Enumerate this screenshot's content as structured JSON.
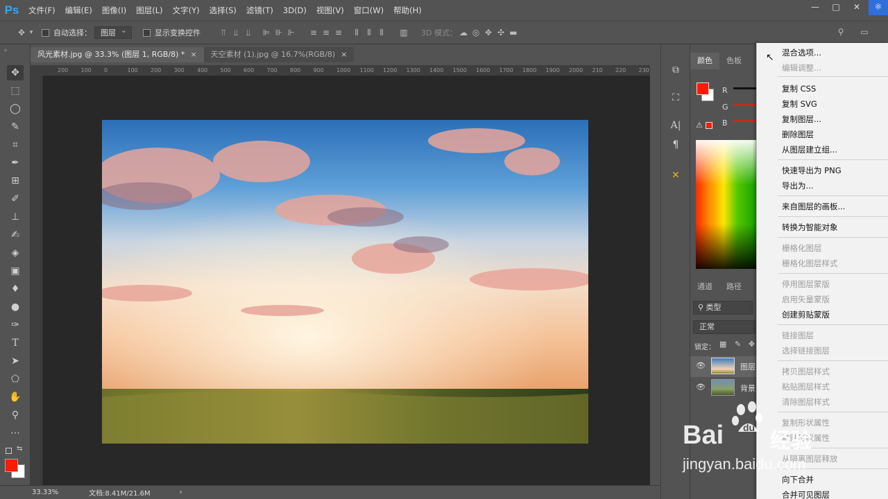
{
  "app": {
    "logo": "Ps"
  },
  "menu": [
    "文件(F)",
    "编辑(E)",
    "图像(I)",
    "图层(L)",
    "文字(Y)",
    "选择(S)",
    "滤镜(T)",
    "3D(D)",
    "视图(V)",
    "窗口(W)",
    "帮助(H)"
  ],
  "window_buttons": {
    "minimize": "—",
    "restore": "□",
    "close": "✕"
  },
  "options": {
    "auto_select_label": "自动选择：",
    "auto_select_value": "图层",
    "show_transform_label": "显示变换控件",
    "mode_3d_label": "3D 模式："
  },
  "tabs": [
    {
      "label": "风光素材.jpg @ 33.3% (图层 1, RGB/8) *",
      "close": "×"
    },
    {
      "label": "天空素材 (1).jpg @ 16.7%(RGB/8)",
      "close": "×"
    }
  ],
  "ruler_ticks": [
    "200",
    "100",
    "0",
    "100",
    "200",
    "300",
    "400",
    "500",
    "600",
    "700",
    "800",
    "900",
    "1000",
    "1100",
    "1200",
    "1300",
    "1400",
    "1500",
    "1600",
    "1700",
    "1800",
    "1900",
    "2000",
    "210",
    "220",
    "230"
  ],
  "status": {
    "zoom": "33.33%",
    "doc": "文档:8.41M/21.6M",
    "arrow": "›"
  },
  "panel": {
    "color_tabs": [
      "颜色",
      "色板"
    ],
    "rgb": [
      "R",
      "G",
      "B"
    ],
    "layer_tabs": [
      "通道",
      "路径"
    ],
    "filter_type": "类型",
    "blend_mode": "正常",
    "lock_label": "锁定：",
    "layers": [
      {
        "name": "图层"
      },
      {
        "name": "背景"
      }
    ]
  },
  "colors": {
    "foreground": "#ff1a00",
    "background": "#ffffff",
    "accent": "#31a8ff"
  },
  "context_menu": [
    {
      "label": "混合选项...",
      "enabled": true
    },
    {
      "label": "编辑调整...",
      "enabled": false
    },
    {
      "label": "复制 CSS",
      "enabled": true
    },
    {
      "label": "复制 SVG",
      "enabled": true
    },
    {
      "label": "复制图层...",
      "enabled": true
    },
    {
      "label": "删除图层",
      "enabled": true
    },
    {
      "label": "从图层建立组...",
      "enabled": true
    },
    {
      "label": "快速导出为 PNG",
      "enabled": true
    },
    {
      "label": "导出为...",
      "enabled": true
    },
    {
      "label": "来自图层的画板...",
      "enabled": true
    },
    {
      "label": "转换为智能对象",
      "enabled": true
    },
    {
      "label": "栅格化图层",
      "enabled": false
    },
    {
      "label": "栅格化图层样式",
      "enabled": false
    },
    {
      "label": "停用图层蒙版",
      "enabled": false
    },
    {
      "label": "启用矢量蒙版",
      "enabled": false
    },
    {
      "label": "创建剪贴蒙版",
      "enabled": true
    },
    {
      "label": "链接图层",
      "enabled": false
    },
    {
      "label": "选择链接图层",
      "enabled": false
    },
    {
      "label": "拷贝图层样式",
      "enabled": false
    },
    {
      "label": "粘贴图层样式",
      "enabled": false
    },
    {
      "label": "清除图层样式",
      "enabled": false
    },
    {
      "label": "复制形状属性",
      "enabled": false
    },
    {
      "label": "粘贴形状属性",
      "enabled": false
    },
    {
      "label": "从隔离图层释放",
      "enabled": false
    },
    {
      "label": "向下合并",
      "enabled": true
    },
    {
      "label": "合并可见图层",
      "enabled": true
    }
  ],
  "watermark": {
    "brand": "Bai",
    "brand2": "经验",
    "url": "jingyan.baidu.com"
  }
}
